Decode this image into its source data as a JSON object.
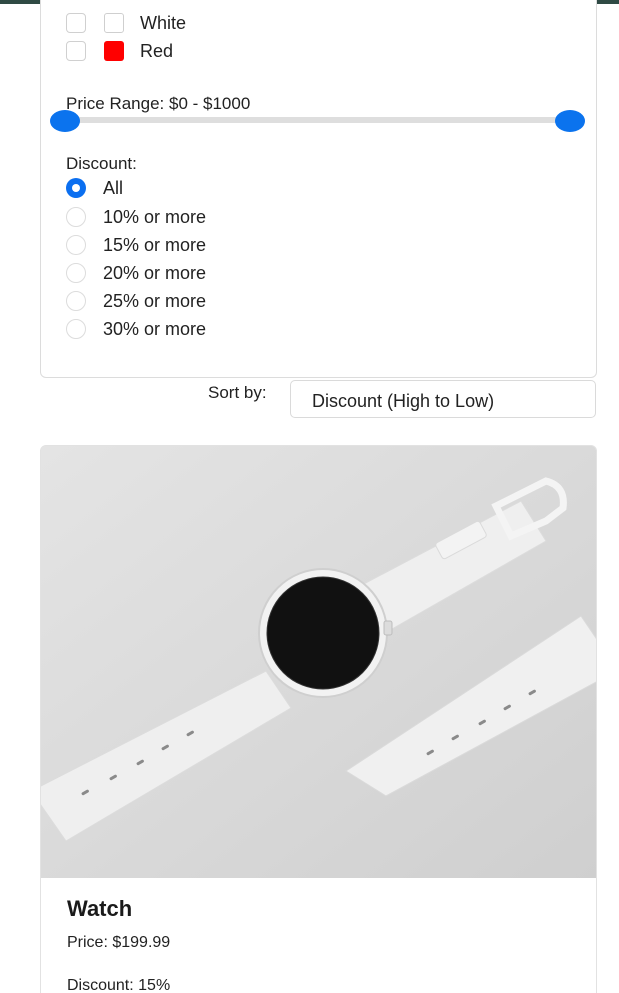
{
  "filters": {
    "colors": [
      {
        "label": "White",
        "swatch": "#ffffff"
      },
      {
        "label": "Red",
        "swatch": "#ff0000"
      }
    ],
    "price_range_label": "Price Range: $0 - $1000",
    "price_range": {
      "min": 0,
      "max": 1000
    },
    "discount_title": "Discount:",
    "discount_options": [
      {
        "label": "All",
        "checked": true
      },
      {
        "label": "10% or more",
        "checked": false
      },
      {
        "label": "15% or more",
        "checked": false
      },
      {
        "label": "20% or more",
        "checked": false
      },
      {
        "label": "25% or more",
        "checked": false
      },
      {
        "label": "30% or more",
        "checked": false
      }
    ]
  },
  "sort": {
    "label": "Sort by:",
    "selected": "Discount (High to Low)"
  },
  "product": {
    "name": "Watch",
    "price": "Price: $199.99",
    "discount": "Discount: 15%"
  },
  "colors": {
    "accent": "#0b73ee",
    "header_bar": "#2f4a44"
  }
}
